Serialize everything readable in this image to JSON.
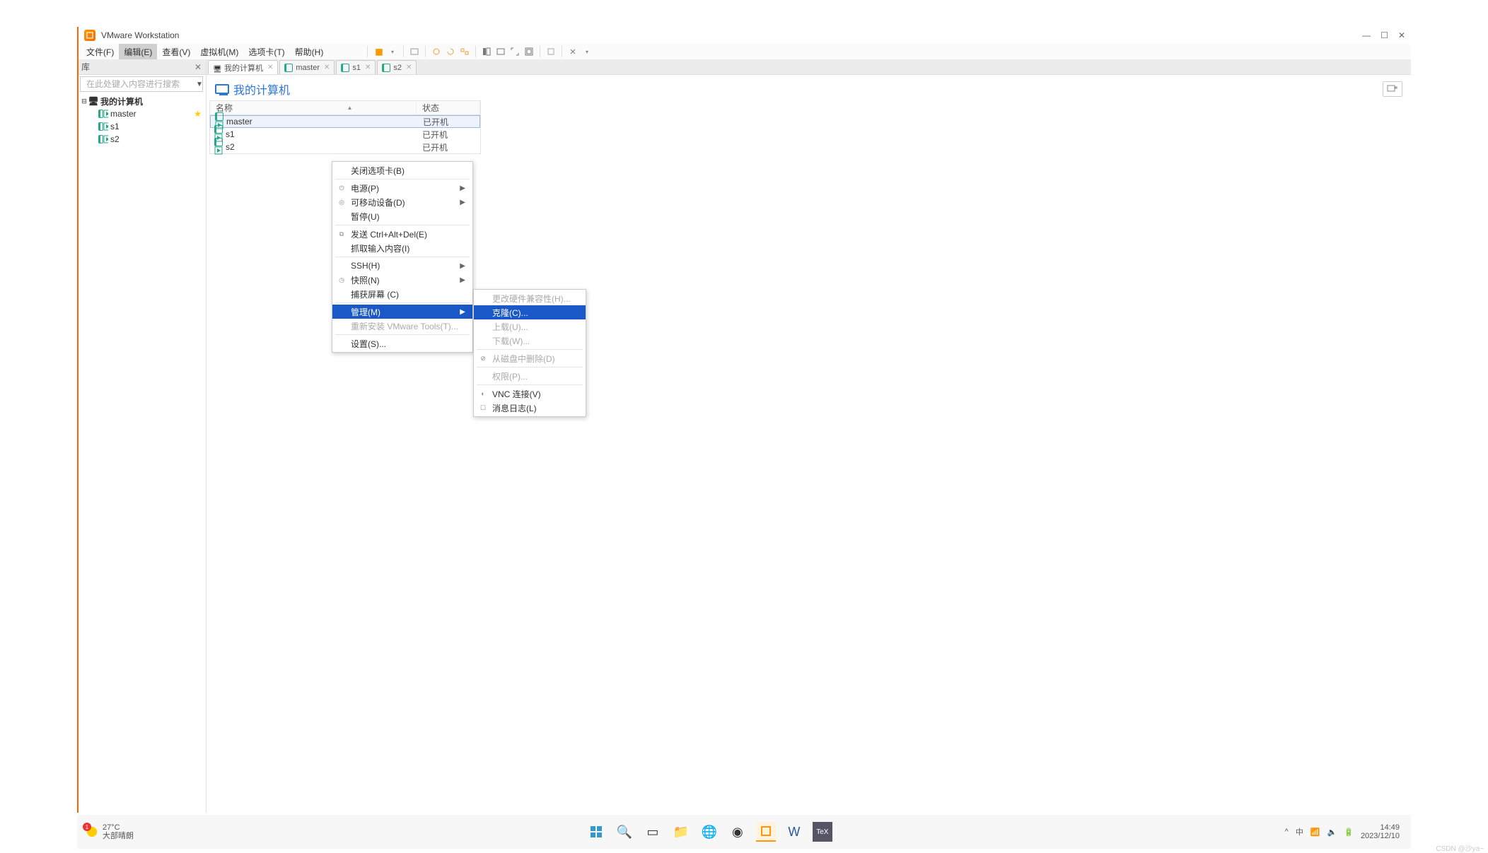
{
  "window": {
    "title": "VMware Workstation"
  },
  "menubar": {
    "items": [
      "文件(F)",
      "编辑(E)",
      "查看(V)",
      "虚拟机(M)",
      "选项卡(T)",
      "帮助(H)"
    ],
    "active_index": 1
  },
  "sidebar": {
    "header": "库",
    "search_placeholder": "在此处键入内容进行搜索",
    "root": "我的计算机",
    "children": [
      "master",
      "s1",
      "s2"
    ]
  },
  "tabs": [
    {
      "label": "我的计算机",
      "kind": "home",
      "active": true
    },
    {
      "label": "master",
      "kind": "vm"
    },
    {
      "label": "s1",
      "kind": "vm"
    },
    {
      "label": "s2",
      "kind": "vm"
    }
  ],
  "content": {
    "page_title": "我的计算机",
    "columns": {
      "name": "名称",
      "state": "状态"
    },
    "rows": [
      {
        "name": "master",
        "state": "已开机",
        "selected": true
      },
      {
        "name": "s1",
        "state": "已开机"
      },
      {
        "name": "s2",
        "state": "已开机"
      }
    ]
  },
  "context_menu": {
    "items": [
      {
        "label": "关闭选项卡(B)"
      },
      {
        "sep": true
      },
      {
        "label": "电源(P)",
        "sub": true,
        "icon": "power"
      },
      {
        "label": "可移动设备(D)",
        "sub": true,
        "icon": "disk"
      },
      {
        "label": "暂停(U)"
      },
      {
        "sep": true
      },
      {
        "label": "发送 Ctrl+Alt+Del(E)",
        "icon": "send"
      },
      {
        "label": "抓取输入内容(I)"
      },
      {
        "sep": true
      },
      {
        "label": "SSH(H)",
        "sub": true
      },
      {
        "label": "快照(N)",
        "sub": true,
        "icon": "snap"
      },
      {
        "label": "捕获屏幕 (C)"
      },
      {
        "sep": true
      },
      {
        "label": "管理(M)",
        "sub": true,
        "hl": true
      },
      {
        "label": "重新安装 VMware Tools(T)...",
        "disabled": true
      },
      {
        "sep": true
      },
      {
        "label": "设置(S)..."
      }
    ]
  },
  "sub_menu": {
    "items": [
      {
        "label": "更改硬件兼容性(H)...",
        "disabled": true
      },
      {
        "label": "克隆(C)...",
        "hl": true
      },
      {
        "label": "上载(U)...",
        "disabled": true
      },
      {
        "label": "下载(W)...",
        "disabled": true
      },
      {
        "sep": true
      },
      {
        "label": "从磁盘中删除(D)",
        "disabled": true
      },
      {
        "sep": true
      },
      {
        "label": "权限(P)...",
        "disabled": true
      },
      {
        "sep": true
      },
      {
        "label": "VNC 连接(V)",
        "icon": "dot"
      },
      {
        "label": "消息日志(L)",
        "icon": "log"
      }
    ]
  },
  "taskbar": {
    "weather": {
      "badge": "1",
      "temp": "27°C",
      "desc": "大部晴朗"
    },
    "tray": {
      "lang": "中",
      "time": "14:49",
      "date": "2023/12/10"
    }
  },
  "watermark": "CSDN @沙ya~"
}
